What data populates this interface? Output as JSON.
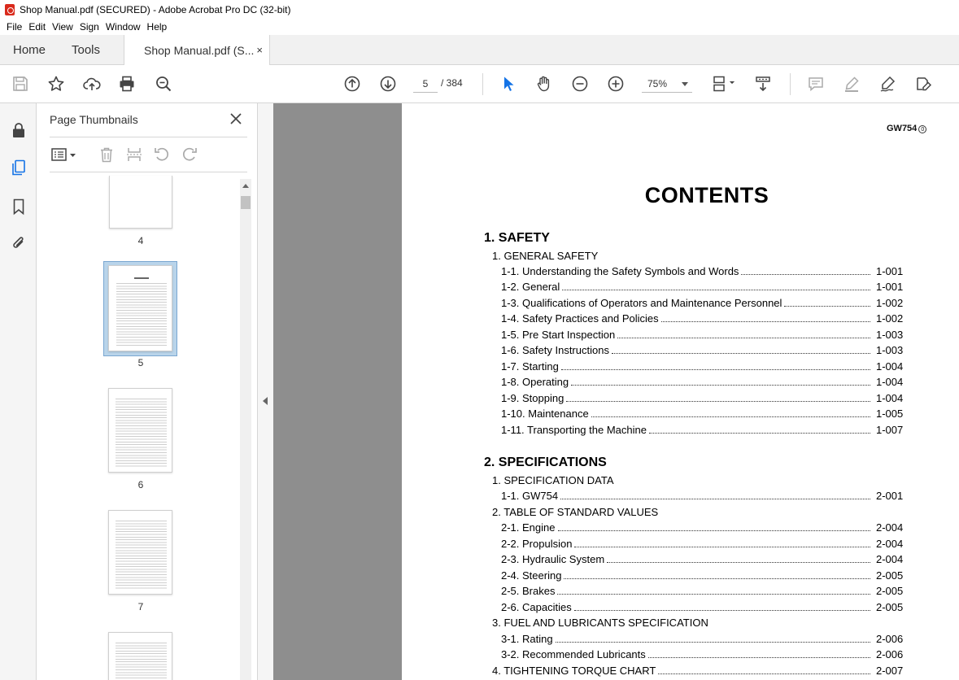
{
  "window": {
    "title": "Shop Manual.pdf (SECURED) - Adobe Acrobat Pro DC (32-bit)"
  },
  "menu": [
    "File",
    "Edit",
    "View",
    "Sign",
    "Window",
    "Help"
  ],
  "tabs": {
    "home": "Home",
    "tools": "Tools",
    "document": "Shop Manual.pdf (S...",
    "close": "×"
  },
  "toolbar": {
    "page_current": "5",
    "page_total": "/ 384",
    "zoom": "75%"
  },
  "thumbnails": {
    "title": "Page Thumbnails",
    "pages": [
      {
        "num": "4"
      },
      {
        "num": "5"
      },
      {
        "num": "6"
      },
      {
        "num": "7"
      }
    ]
  },
  "document": {
    "page_id": "GW754",
    "page_id_mark": "0",
    "heading": "CONTENTS",
    "sections": [
      {
        "title": "1. SAFETY",
        "groups": [
          {
            "title": "1. GENERAL SAFETY",
            "entries": [
              {
                "label": "1-1. Understanding the Safety Symbols and Words",
                "page": "1-001"
              },
              {
                "label": "1-2. General",
                "page": "1-001"
              },
              {
                "label": "1-3. Qualifications of Operators and Maintenance Personnel",
                "page": "1-002"
              },
              {
                "label": "1-4. Safety Practices and Policies",
                "page": "1-002"
              },
              {
                "label": "1-5. Pre Start Inspection",
                "page": "1-003"
              },
              {
                "label": "1-6. Safety Instructions",
                "page": "1-003"
              },
              {
                "label": "1-7. Starting",
                "page": "1-004"
              },
              {
                "label": "1-8. Operating",
                "page": "1-004"
              },
              {
                "label": "1-9. Stopping",
                "page": "1-004"
              },
              {
                "label": "1-10. Maintenance",
                "page": "1-005"
              },
              {
                "label": "1-11. Transporting the Machine",
                "page": "1-007"
              }
            ]
          }
        ]
      },
      {
        "title": "2. SPECIFICATIONS",
        "groups": [
          {
            "title": "1. SPECIFICATION DATA",
            "entries": [
              {
                "label": "1-1. GW754",
                "page": "2-001"
              }
            ]
          },
          {
            "title": "2. TABLE OF STANDARD VALUES",
            "entries": [
              {
                "label": "2-1. Engine",
                "page": "2-004"
              },
              {
                "label": "2-2. Propulsion",
                "page": "2-004"
              },
              {
                "label": "2-3. Hydraulic System",
                "page": "2-004"
              },
              {
                "label": "2-4. Steering",
                "page": "2-005"
              },
              {
                "label": "2-5. Brakes",
                "page": "2-005"
              },
              {
                "label": "2-6. Capacities",
                "page": "2-005"
              }
            ]
          },
          {
            "title": "3. FUEL AND LUBRICANTS SPECIFICATION",
            "entries": [
              {
                "label": "3-1. Rating",
                "page": "2-006"
              },
              {
                "label": "3-2. Recommended Lubricants",
                "page": "2-006"
              }
            ]
          }
        ]
      }
    ],
    "last_entry": {
      "label": "4. TIGHTENING TORQUE CHART",
      "page": "2-007"
    }
  }
}
